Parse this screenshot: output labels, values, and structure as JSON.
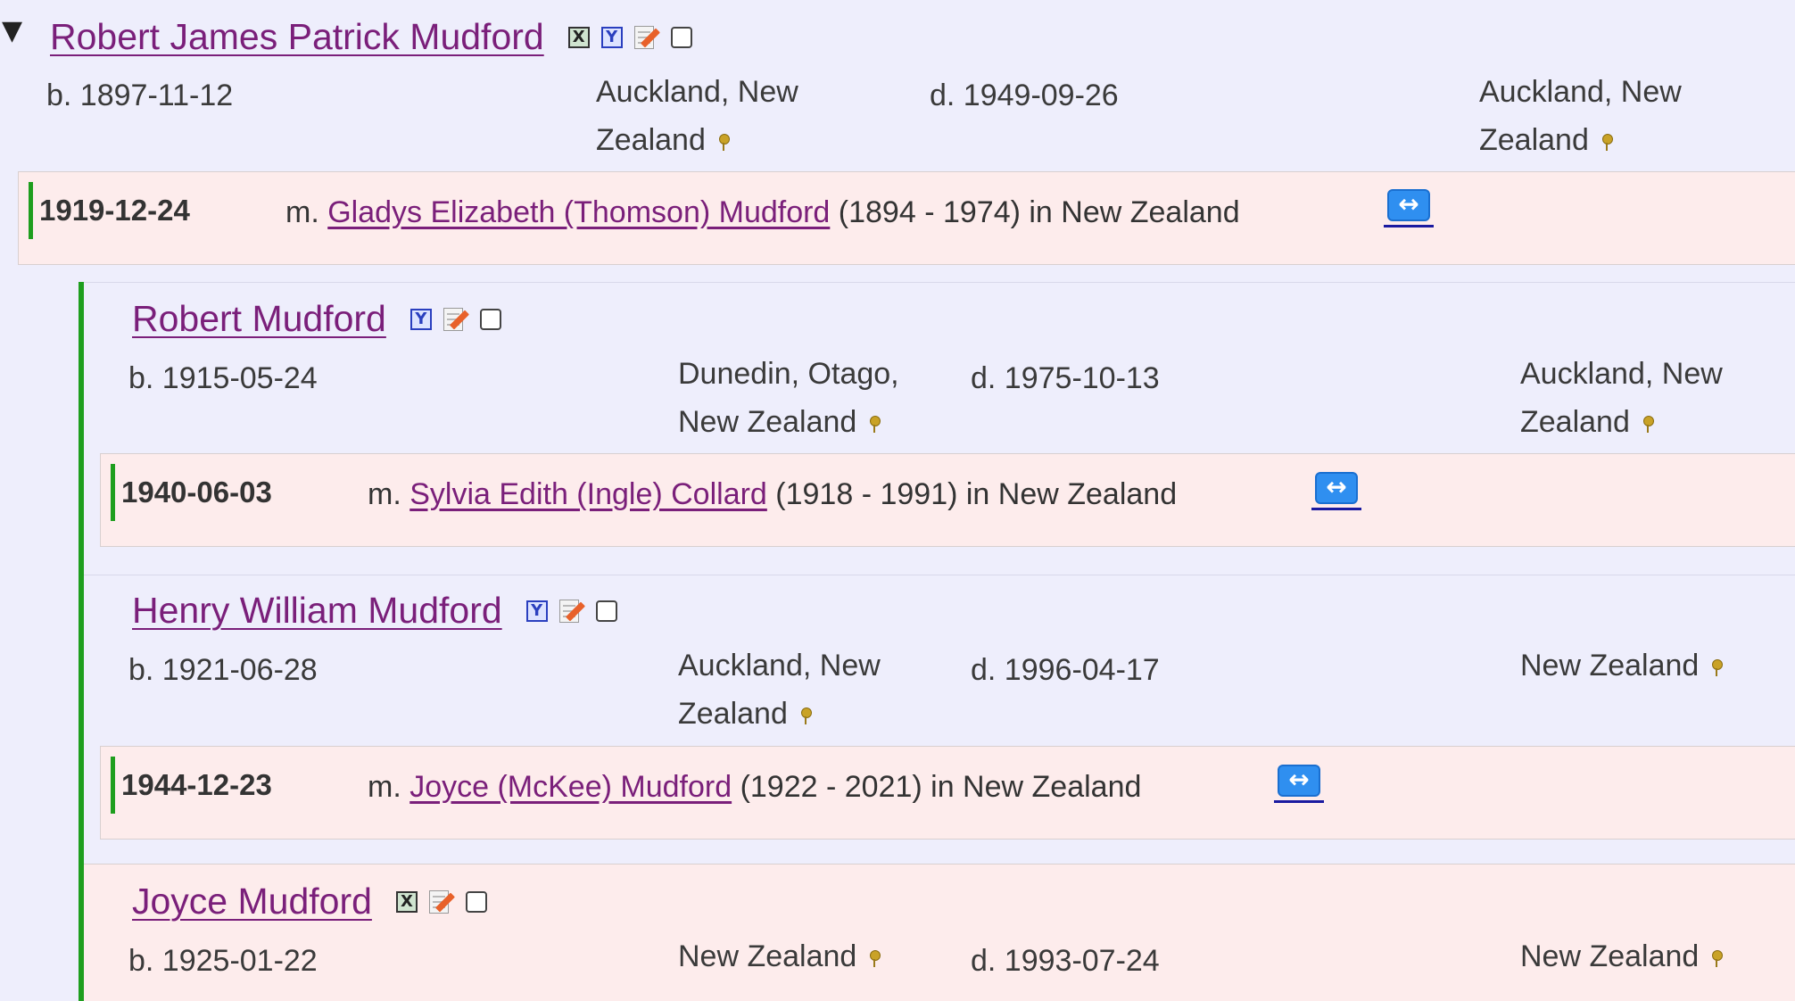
{
  "toggle_symbol": "▼",
  "persons": [
    {
      "name": "Robert James Patrick Mudford",
      "birth": "b. 1897-11-12",
      "birth_place_1": "Auckland, New",
      "birth_place_2": "Zealand",
      "death": "d. 1949-09-26",
      "death_place_1": "Auckland, New",
      "death_place_2": "Zealand",
      "marriage_date": "1919-12-24",
      "marriage_prefix": "m. ",
      "spouse": "Gladys Elizabeth (Thomson) Mudford",
      "marriage_suffix": " (1894 - 1974) in New Zealand"
    },
    {
      "name": "Robert Mudford",
      "birth": "b. 1915-05-24",
      "birth_place_1": "Dunedin, Otago,",
      "birth_place_2": "New Zealand",
      "death": "d. 1975-10-13",
      "death_place_1": "Auckland, New",
      "death_place_2": "Zealand",
      "marriage_date": "1940-06-03",
      "marriage_prefix": "m. ",
      "spouse": "Sylvia Edith (Ingle) Collard",
      "marriage_suffix": " (1918 - 1991) in New Zealand"
    },
    {
      "name": "Henry William Mudford",
      "birth": "b. 1921-06-28",
      "birth_place_1": "Auckland, New",
      "birth_place_2": "Zealand",
      "death": "d. 1996-04-17",
      "death_place_1": "New Zealand",
      "marriage_date": "1944-12-23",
      "marriage_prefix": "m. ",
      "spouse": "Joyce (McKee) Mudford",
      "marriage_suffix": " (1922 - 2021) in New Zealand"
    },
    {
      "name": "Joyce Mudford",
      "birth": "b. 1925-01-22",
      "birth_place_1": "New Zealand",
      "death": "d. 1993-07-24",
      "death_place_1": "New Zealand"
    }
  ],
  "icons": {
    "x_glyph": "X",
    "y_glyph": "Y",
    "swap_glyph": "↔"
  },
  "colors": {
    "link": "#7a1f7a",
    "person_bg": "#eeeefc",
    "marriage_bg": "#fdecec",
    "descendant_bar": "#1e9e1e",
    "swap_blue": "#2f8ff0"
  }
}
